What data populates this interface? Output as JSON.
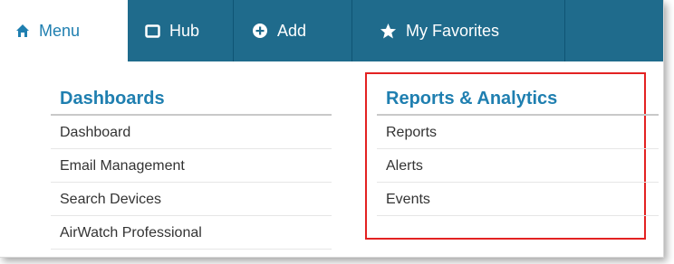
{
  "navbar": {
    "items": [
      {
        "label": "Menu",
        "icon": "home-icon",
        "active": true
      },
      {
        "label": "Hub",
        "icon": "square-icon",
        "active": false
      },
      {
        "label": "Add",
        "icon": "plus-circle-icon",
        "active": false
      },
      {
        "label": "My Favorites",
        "icon": "star-icon",
        "active": false
      }
    ]
  },
  "sections": {
    "dashboards": {
      "title": "Dashboards",
      "items": [
        "Dashboard",
        "Email Management",
        "Search Devices",
        "AirWatch Professional"
      ]
    },
    "reports": {
      "title": "Reports & Analytics",
      "items": [
        "Reports",
        "Alerts",
        "Events"
      ]
    }
  },
  "colors": {
    "nav_bg": "#1f6b8c",
    "accent": "#1f7fb0",
    "highlight": "#e32222"
  }
}
